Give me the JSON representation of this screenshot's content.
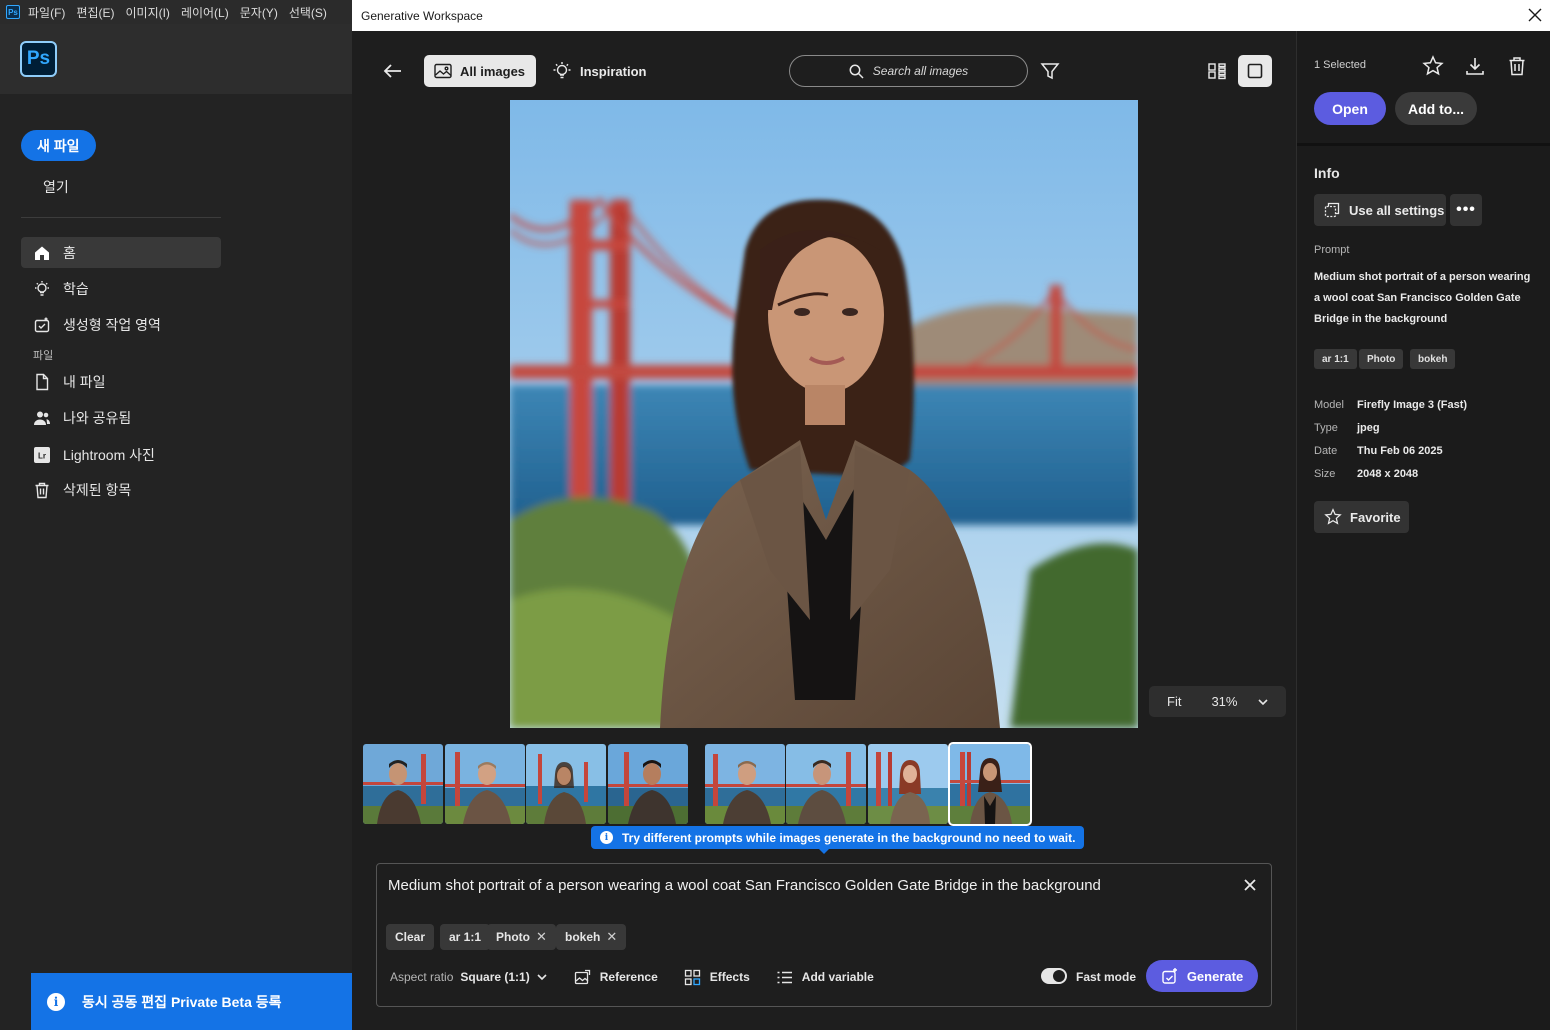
{
  "menubar": {
    "app_icon": "Ps",
    "items": [
      "파일(F)",
      "편집(E)",
      "이미지(I)",
      "레이어(L)",
      "문자(Y)",
      "선택(S)"
    ]
  },
  "left": {
    "logo": "Ps",
    "new_file": "새 파일",
    "open": "열기",
    "nav": [
      {
        "label": "홈",
        "icon": "home-icon"
      },
      {
        "label": "학습",
        "icon": "lightbulb-icon"
      },
      {
        "label": "생성형 작업 영역",
        "icon": "generative-workspace-icon"
      },
      {
        "label": "내 파일",
        "icon": "file-icon"
      },
      {
        "label": "나와 공유됨",
        "icon": "shared-users-icon"
      },
      {
        "label": "Lightroom 사진",
        "icon": "lightroom-icon"
      },
      {
        "label": "삭제된 항목",
        "icon": "trash-icon"
      }
    ],
    "files_section": "파일",
    "lightroom_badge": "Lr",
    "beta_banner": "동시 공동 편집 Private Beta 등록"
  },
  "window": {
    "title": "Generative Workspace"
  },
  "toolbar": {
    "all_images": "All images",
    "inspiration": "Inspiration",
    "search_placeholder": "Search all images"
  },
  "zoom": {
    "fit": "Fit",
    "percent": "31%"
  },
  "tip": "Try different prompts while images generate in the background no need to wait.",
  "prompt_box": {
    "text": "Medium shot portrait of a person wearing a wool coat San Francisco Golden Gate Bridge in the background",
    "chips": [
      {
        "label": "Clear",
        "removable": false
      },
      {
        "label": "ar 1:1",
        "removable": false
      },
      {
        "label": "Photo",
        "removable": true
      },
      {
        "label": "bokeh",
        "removable": true
      }
    ],
    "chip_remove": "✕",
    "aspect_label": "Aspect ratio",
    "aspect_value": "Square (1:1)",
    "reference": "Reference",
    "effects": "Effects",
    "add_variable": "Add variable",
    "fast_mode": "Fast mode",
    "generate": "Generate"
  },
  "right": {
    "selected": "1 Selected",
    "open": "Open",
    "add_to": "Add to...",
    "info_title": "Info",
    "use_all_settings": "Use all settings",
    "more": "•••",
    "prompt_label": "Prompt",
    "prompt_value": "Medium shot portrait of a person wearing a wool coat San Francisco Golden Gate Bridge in the background",
    "tags": [
      "ar 1:1",
      "Photo",
      "bokeh"
    ],
    "meta": [
      {
        "key": "Model",
        "value": "Firefly Image 3 (Fast)"
      },
      {
        "key": "Type",
        "value": "jpeg"
      },
      {
        "key": "Date",
        "value": "Thu Feb 06 2025"
      },
      {
        "key": "Size",
        "value": "2048 x 2048"
      }
    ],
    "favorite": "Favorite"
  },
  "colors": {
    "accent_blue": "#1473e6",
    "accent_purple": "#5c5ce0"
  }
}
